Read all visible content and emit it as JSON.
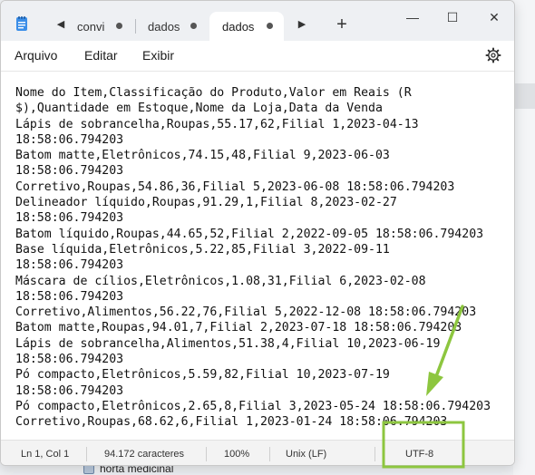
{
  "tabs": [
    {
      "label": "convi",
      "active": false
    },
    {
      "label": "dados",
      "active": false
    },
    {
      "label": "dados",
      "active": true
    }
  ],
  "window_controls": {
    "minimize": "—",
    "maximize": "☐",
    "close": "✕"
  },
  "new_tab": "+",
  "menu": {
    "file": "Arquivo",
    "edit": "Editar",
    "view": "Exibir"
  },
  "editor_lines": [
    "Nome do Item,Classificação do Produto,Valor em Reais (R",
    "$),Quantidade em Estoque,Nome da Loja,Data da Venda",
    "Lápis de sobrancelha,Roupas,55.17,62,Filial 1,2023-04-13",
    "18:58:06.794203",
    "Batom matte,Eletrônicos,74.15,48,Filial 9,2023-06-03",
    "18:58:06.794203",
    "Corretivo,Roupas,54.86,36,Filial 5,2023-06-08 18:58:06.794203",
    "Delineador líquido,Roupas,91.29,1,Filial 8,2023-02-27",
    "18:58:06.794203",
    "Batom líquido,Roupas,44.65,52,Filial 2,2022-09-05 18:58:06.794203",
    "Base líquida,Eletrônicos,5.22,85,Filial 3,2022-09-11",
    "18:58:06.794203",
    "Máscara de cílios,Eletrônicos,1.08,31,Filial 6,2023-02-08",
    "18:58:06.794203",
    "Corretivo,Alimentos,56.22,76,Filial 5,2022-12-08 18:58:06.794203",
    "Batom matte,Roupas,94.01,7,Filial 2,2023-07-18 18:58:06.794203",
    "Lápis de sobrancelha,Alimentos,51.38,4,Filial 10,2023-06-19",
    "18:58:06.794203",
    "Pó compacto,Eletrônicos,5.59,82,Filial 10,2023-07-19",
    "18:58:06.794203",
    "Pó compacto,Eletrônicos,2.65,8,Filial 3,2023-05-24 18:58:06.794203",
    "Corretivo,Roupas,68.62,6,Filial 1,2023-01-24 18:58:06.794203"
  ],
  "status": {
    "position": "Ln 1, Col 1",
    "chars": "94.172 caracteres",
    "zoom": "100%",
    "line_ending": "Unix (LF)",
    "encoding": "UTF-8"
  },
  "background_item": "horta medicinal",
  "annotation_color": "#8dc63f",
  "icons": {
    "app": "notepad-icon",
    "settings": "gear-icon",
    "back": "chevron-left-icon",
    "forward": "chevron-right-icon"
  }
}
